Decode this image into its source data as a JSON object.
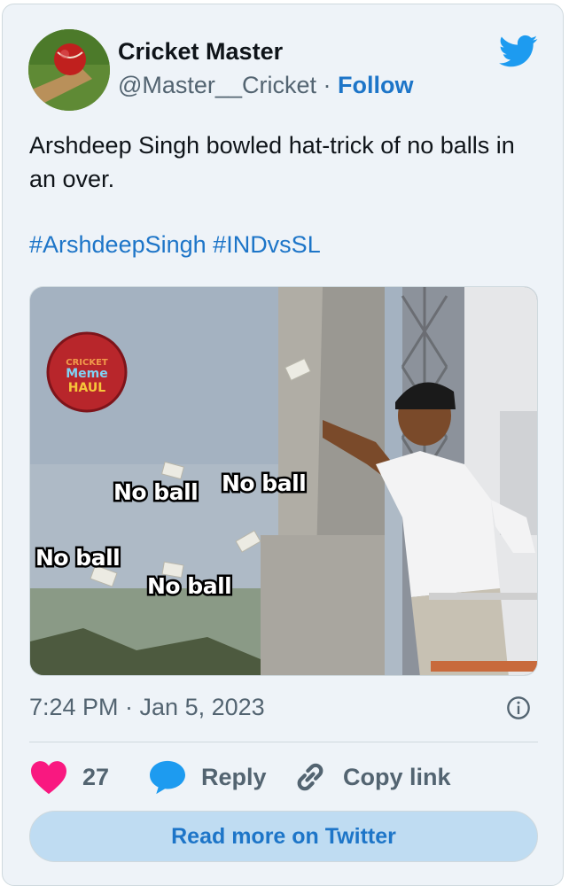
{
  "author": {
    "name": "Cricket Master",
    "handle": "@Master__Cricket",
    "separator": "·",
    "follow_label": "Follow"
  },
  "tweet": {
    "text": "Arshdeep Singh bowled hat-trick of no balls in an over.",
    "hashtags": [
      "#ArshdeepSingh",
      "#INDvsSL"
    ]
  },
  "media": {
    "logo_lines": [
      "CRICKET",
      "Meme",
      "HAUL"
    ],
    "captions": [
      "No ball",
      "No ball",
      "No ball",
      "No ball"
    ]
  },
  "timestamp": "7:24 PM · Jan 5, 2023",
  "actions": {
    "like_count": "27",
    "reply_label": "Reply",
    "copy_label": "Copy link"
  },
  "read_more_label": "Read more on Twitter",
  "colors": {
    "accent": "#1d75c8",
    "like": "#f91880",
    "reply_icon": "#1d9bf0",
    "card_bg": "#eef3f8"
  },
  "icons": [
    "twitter-bird-icon",
    "info-icon",
    "heart-icon",
    "reply-bubble-icon",
    "link-icon"
  ]
}
